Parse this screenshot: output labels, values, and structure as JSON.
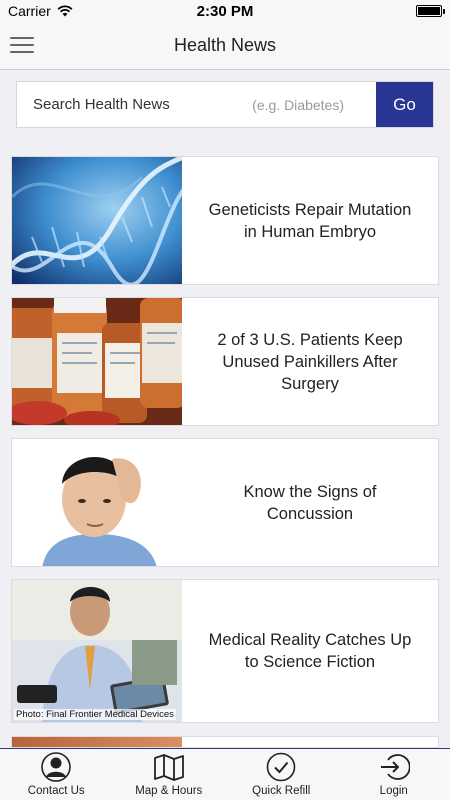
{
  "status_bar": {
    "carrier": "Carrier",
    "time": "2:30 PM",
    "battery_level": 1.0
  },
  "nav": {
    "title": "Health News",
    "menu_icon": "hamburger-menu-icon"
  },
  "search": {
    "label": "Search Health News",
    "hint": "(e.g. Diabetes)",
    "button": "Go",
    "button_color": "#283593"
  },
  "articles": [
    {
      "headline": "Geneticists Repair Mutation in Human Embryo",
      "image": "dna-helix-image"
    },
    {
      "headline": "2 of 3 U.S. Patients Keep Unused Painkillers After Surgery",
      "image": "pill-bottles-image"
    },
    {
      "headline": "Know the Signs of Concussion",
      "image": "boy-holding-head-image"
    },
    {
      "headline": "Medical Reality Catches Up to Science Fiction",
      "image": "man-with-tablet-image",
      "credit": "Photo: Final Frontier Medical Devices"
    }
  ],
  "tabs": [
    {
      "label": "Contact Us",
      "icon": "person-icon"
    },
    {
      "label": "Map & Hours",
      "icon": "map-icon"
    },
    {
      "label": "Quick Refill",
      "icon": "check-circle-icon"
    },
    {
      "label": "Login",
      "icon": "login-arrow-icon"
    }
  ]
}
